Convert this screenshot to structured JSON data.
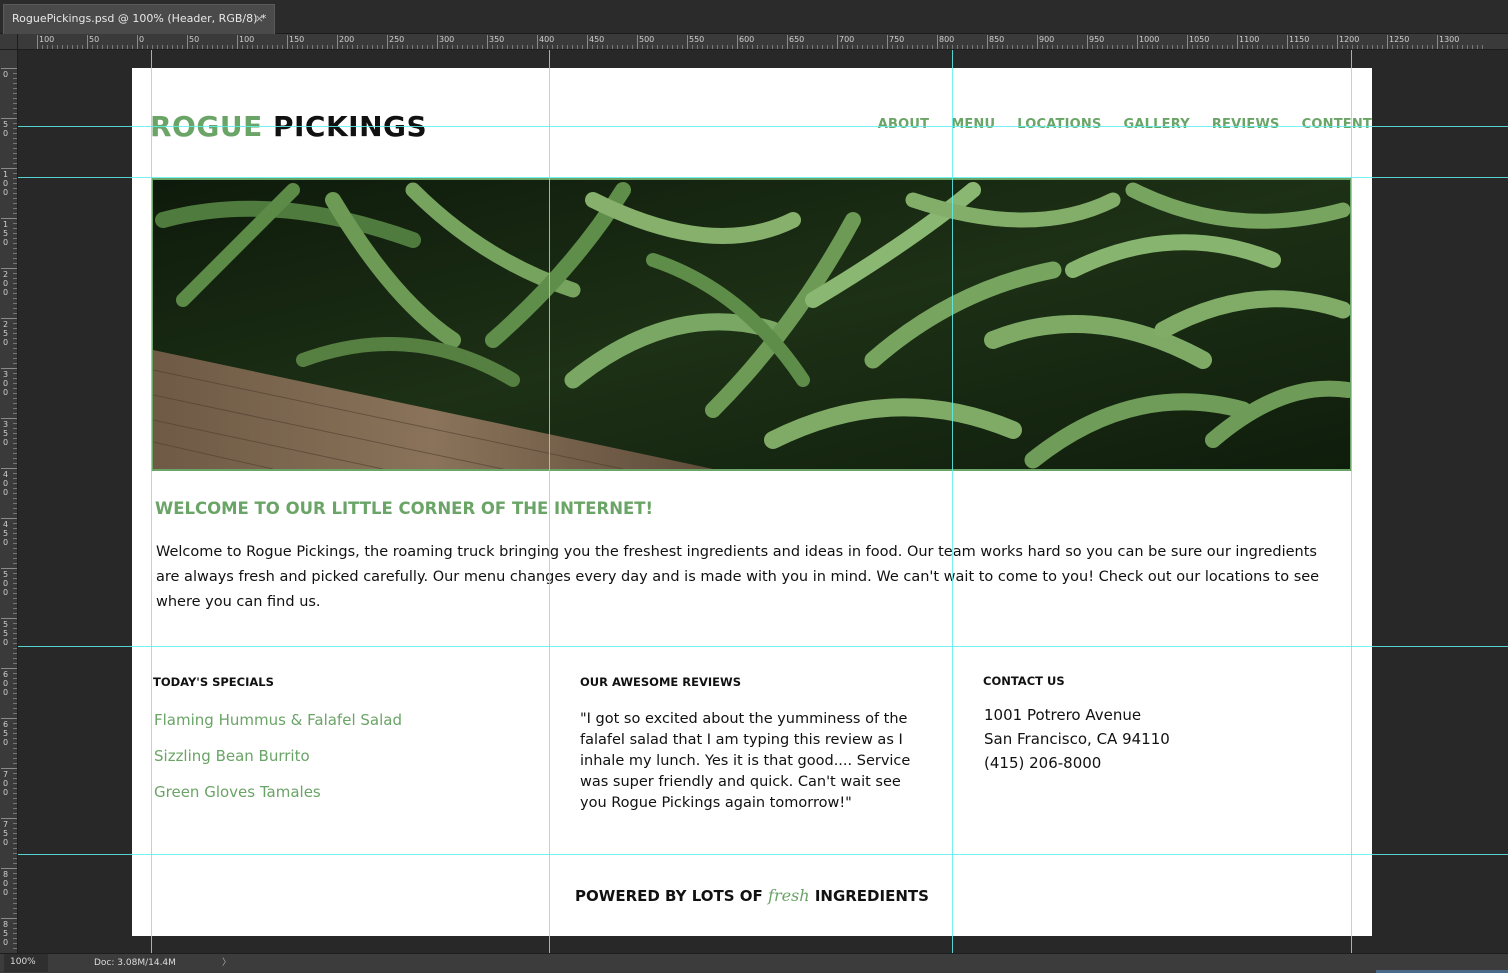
{
  "window": {
    "tab_title": "RoguePickings.psd @ 100% (Header, RGB/8) *",
    "tab_close": "×"
  },
  "ruler": {
    "top_labels": [
      "100",
      "50",
      "0",
      "50",
      "100",
      "150",
      "200",
      "250",
      "300",
      "350",
      "400",
      "450",
      "500",
      "550",
      "600",
      "650",
      "700",
      "750",
      "800",
      "850",
      "900",
      "950",
      "1000",
      "1050",
      "1100",
      "1150",
      "1200",
      "1250",
      "1300"
    ],
    "left_labels": [
      "0",
      "50",
      "100",
      "150",
      "200",
      "250",
      "300",
      "350",
      "400",
      "450",
      "500",
      "550",
      "600",
      "650",
      "700",
      "750",
      "800",
      "850"
    ]
  },
  "site": {
    "logo_first": "ROGUE",
    "logo_second": "PICKINGS",
    "nav": [
      "ABOUT",
      "MENU",
      "LOCATIONS",
      "GALLERY",
      "REVIEWS",
      "CONTENT"
    ],
    "welcome_title": "WELCOME TO OUR LITTLE CORNER OF THE INTERNET!",
    "welcome_body": "Welcome to Rogue Pickings, the roaming truck bringing you the freshest ingredients and ideas in food. Our team works hard so you can be sure our ingredients are always fresh and picked carefully. Our menu changes every day and is made with you in mind. We can't wait to come to you! Check out our locations to see where you can find us.",
    "specials_title": "TODAY'S SPECIALS",
    "specials": [
      "Flaming Hummus & Falafel Salad",
      "Sizzling Bean Burrito",
      "Green Gloves Tamales"
    ],
    "reviews_title": "OUR AWESOME REVIEWS",
    "review_text": "\"I got so excited about the yumminess of the falafel salad that I am typing this review as I inhale my lunch. Yes it is that good.... Service was super friendly and quick. Can't wait see you Rogue Pickings again tomorrow!\"",
    "contact_title": "CONTACT US",
    "contact_lines": [
      "1001 Potrero Avenue",
      "San Francisco, CA 94110",
      "(415) 206-8000"
    ],
    "footer_before": "POWERED BY LOTS OF",
    "footer_fresh": "fresh",
    "footer_after": "INGREDIENTS"
  },
  "status": {
    "zoom": "100%",
    "doc": "Doc: 3.08M/14.4M",
    "arrow": "〉"
  },
  "colors": {
    "accent_green": "#6aa466",
    "guide_cyan": "#5ef0ef",
    "workspace": "#282828"
  }
}
